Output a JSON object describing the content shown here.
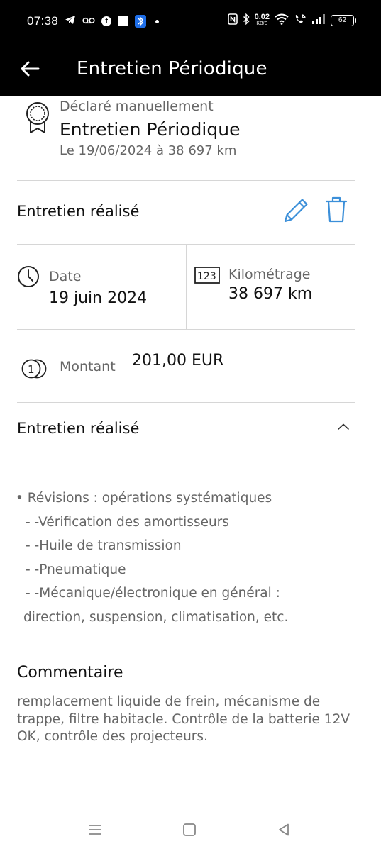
{
  "status_bar": {
    "time": "07:38",
    "speed_value": "0.02",
    "speed_unit": "KB/S",
    "battery": "62",
    "left_icons": [
      "telegram-icon",
      "voicemail-icon",
      "facebook-icon",
      "news-icon",
      "bluetooth-app-icon",
      "dot-icon"
    ],
    "right_icons": [
      "nfc-icon",
      "bluetooth-icon",
      "wifi-icon",
      "wifi-call-icon",
      "signal-icon"
    ]
  },
  "app_bar": {
    "title": "Entretien Périodique",
    "back_icon": "arrow-left-icon"
  },
  "header": {
    "icon": "award-badge-icon",
    "source": "Déclaré manuellement",
    "title": "Entretien Périodique",
    "date_line": "Le 19/06/2024 à 38 697 km"
  },
  "actions": {
    "title": "Entretien réalisé",
    "edit_icon": "pencil-icon",
    "delete_icon": "trash-icon"
  },
  "stats": {
    "date_label": "Date",
    "date_value": "19 juin 2024",
    "mileage_label": "Kilométrage",
    "mileage_value": "38 697 km",
    "amount_label": "Montant",
    "amount_value": "201,00 EUR"
  },
  "details": {
    "title": "Entretien réalisé",
    "toggle_icon": "chevron-up-icon",
    "lines": [
      "• Révisions : opérations systématiques",
      " - -Vérification des amortisseurs",
      " - -Huile de transmission",
      " - -Pneumatique",
      " - -Mécanique/électronique en général :",
      "direction, suspension, climatisation, etc."
    ]
  },
  "comment": {
    "title": "Commentaire",
    "text": "remplacement liquide de frein, mécanisme de trappe, filtre habitacle. Contrôle de la batterie 12V OK, contrôle des projecteurs."
  },
  "nav_bar": {
    "icons": [
      "menu-icon",
      "home-square-icon",
      "back-triangle-icon"
    ]
  },
  "colors": {
    "accent_blue": "#3b8fd9",
    "text_primary": "#111111",
    "text_secondary": "#666666",
    "divider": "#d6d6d6"
  }
}
